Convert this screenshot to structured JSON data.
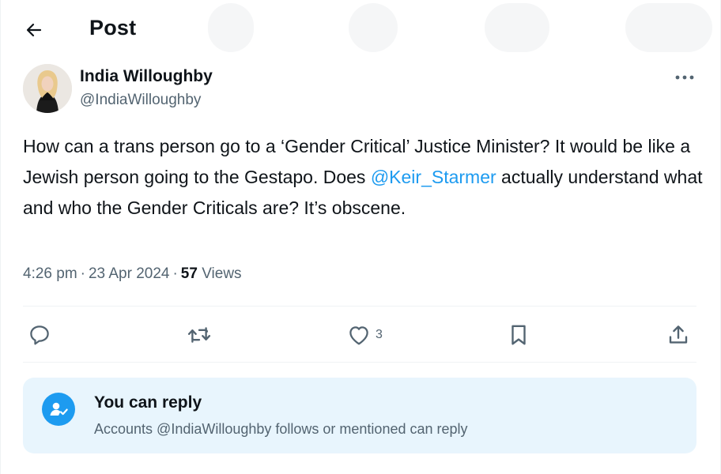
{
  "header": {
    "title": "Post",
    "back_icon": "arrow-left-icon"
  },
  "author": {
    "name": "India Willoughby",
    "handle": "@IndiaWilloughby",
    "more_icon": "more-horizontal-icon"
  },
  "tweet": {
    "text_before": "How can a trans person go to a ‘Gender Critical’ Justice Minister? It would be like a Jewish person going to the Gestapo. Does ",
    "mention": "@Keir_Starmer",
    "text_after": " actually understand what and who the Gender Criticals are? It’s obscene."
  },
  "meta": {
    "time": "4:26 pm",
    "separator": "·",
    "date": "23 Apr 2024",
    "views_count": "57",
    "views_label": "Views"
  },
  "actions": {
    "reply_icon": "reply-icon",
    "retweet_icon": "retweet-icon",
    "like_icon": "heart-icon",
    "like_count": "3",
    "bookmark_icon": "bookmark-icon",
    "share_icon": "share-icon"
  },
  "reply_notice": {
    "title": "You can reply",
    "subtitle": "Accounts @IndiaWilloughby follows or mentioned can reply",
    "icon": "user-check-icon"
  },
  "colors": {
    "accent": "#1d9bf0",
    "text": "#0f1419",
    "muted": "#536471",
    "notice_bg": "#e8f5fd"
  }
}
